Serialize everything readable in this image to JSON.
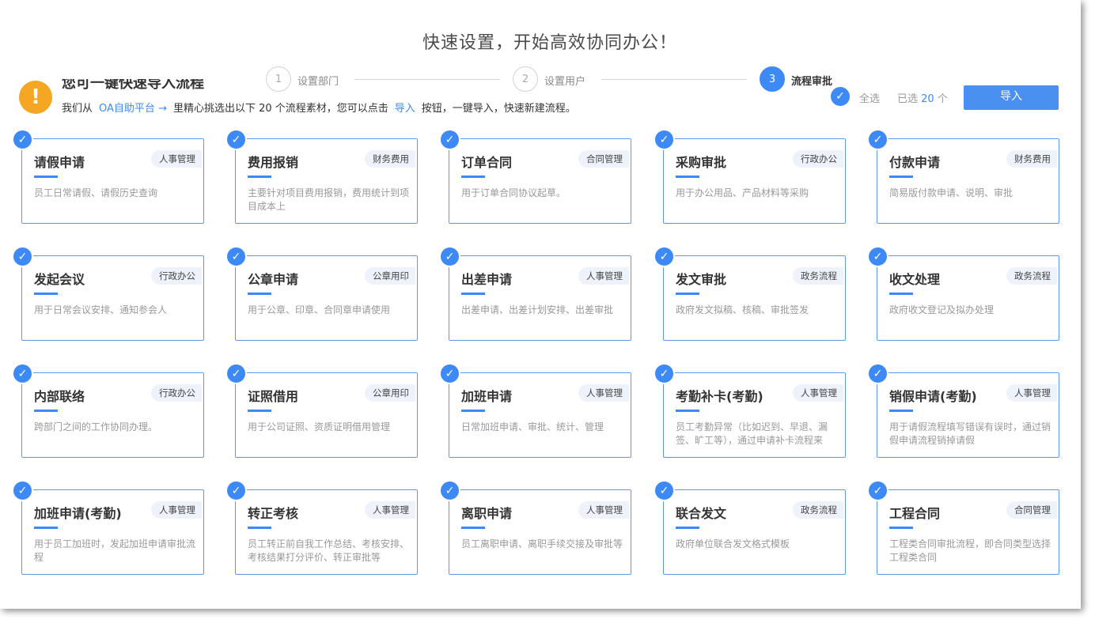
{
  "title": "快速设置，开始高效协同办公！",
  "steps": [
    {
      "num": "1",
      "label": "设置部门"
    },
    {
      "num": "2",
      "label": "设置用户"
    },
    {
      "num": "3",
      "label": "流程审批"
    }
  ],
  "intro": {
    "icon": "!",
    "heading": "您可一键快速导入流程",
    "text_1": "我们从",
    "platform_link": "OA自助平台",
    "arrow": "→",
    "text_2": "里精心挑选出以下 20 个流程素材，您可以点击",
    "import_link": "导入",
    "text_3": "按钮，一键导入，快速新建流程。"
  },
  "toolbar": {
    "check_icon": "✓",
    "select_all": "全选",
    "selected_prefix": "已选",
    "selected_count": "20",
    "selected_suffix": "个",
    "import_label": "导入"
  },
  "cards": [
    {
      "title": "请假申请",
      "tag": "人事管理",
      "desc": "员工日常请假、请假历史查询"
    },
    {
      "title": "费用报销",
      "tag": "财务费用",
      "desc": "主要针对项目费用报销，费用统计到项目成本上"
    },
    {
      "title": "订单合同",
      "tag": "合同管理",
      "desc": "用于订单合同协议起草。"
    },
    {
      "title": "采购审批",
      "tag": "行政办公",
      "desc": "用于办公用品、产品材料等采购"
    },
    {
      "title": "付款申请",
      "tag": "财务费用",
      "desc": "简易版付款申请、说明、审批"
    },
    {
      "title": "发起会议",
      "tag": "行政办公",
      "desc": "用于日常会议安排、通知参会人"
    },
    {
      "title": "公章申请",
      "tag": "公章用印",
      "desc": "用于公章、印章、合同章申请使用"
    },
    {
      "title": "出差申请",
      "tag": "人事管理",
      "desc": "出差申请、出差计划安排、出差审批"
    },
    {
      "title": "发文审批",
      "tag": "政务流程",
      "desc": "政府发文拟稿、核稿、审批签发"
    },
    {
      "title": "收文处理",
      "tag": "政务流程",
      "desc": "政府收文登记及拟办处理"
    },
    {
      "title": "内部联络",
      "tag": "行政办公",
      "desc": "跨部门之间的工作协同办理。"
    },
    {
      "title": "证照借用",
      "tag": "公章用印",
      "desc": "用于公司证照、资质证明借用管理"
    },
    {
      "title": "加班申请",
      "tag": "人事管理",
      "desc": "日常加班申请、审批、统计、管理"
    },
    {
      "title": "考勤补卡(考勤)",
      "tag": "人事管理",
      "desc": "员工考勤异常（比如迟到、早退、漏签、旷工等），通过申请补卡流程来"
    },
    {
      "title": "销假申请(考勤)",
      "tag": "人事管理",
      "desc": "用于请假流程填写错误有误时，通过销假申请流程销掉请假"
    },
    {
      "title": "加班申请(考勤)",
      "tag": "人事管理",
      "desc": "用于员工加班时，发起加班申请审批流程"
    },
    {
      "title": "转正考核",
      "tag": "人事管理",
      "desc": "员工转正前自我工作总结、考核安排、考核结果打分评价、转正审批等"
    },
    {
      "title": "离职申请",
      "tag": "人事管理",
      "desc": "员工离职申请、离职手续交接及审批等"
    },
    {
      "title": "联合发文",
      "tag": "政务流程",
      "desc": "政府单位联合发文格式模板"
    },
    {
      "title": "工程合同",
      "tag": "合同管理",
      "desc": "工程类合同审批流程，即合同类型选择工程类合同"
    }
  ]
}
